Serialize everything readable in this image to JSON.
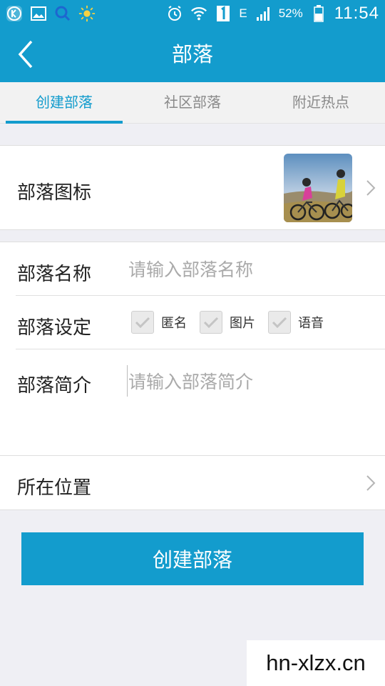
{
  "status_bar": {
    "icons": [
      "k-app-icon",
      "gallery-icon",
      "search-icon",
      "weather-sun-icon",
      "alarm-icon",
      "wifi-icon",
      "sim-1-icon",
      "signal-icon",
      "battery-icon"
    ],
    "network_type": "E",
    "battery": "52%",
    "time": "11:54"
  },
  "header": {
    "title": "部落"
  },
  "tabs": [
    {
      "label": "创建部落",
      "active": true
    },
    {
      "label": "社区部落",
      "active": false
    },
    {
      "label": "附近热点",
      "active": false
    }
  ],
  "form": {
    "icon_label": "部落图标",
    "name_label": "部落名称",
    "name_placeholder": "请输入部落名称",
    "name_value": "",
    "setting_label": "部落设定",
    "settings": [
      {
        "label": "匿名",
        "checked": false
      },
      {
        "label": "图片",
        "checked": false
      },
      {
        "label": "语音",
        "checked": false
      }
    ],
    "intro_label": "部落简介",
    "intro_placeholder": "请输入部落简介",
    "intro_value": "",
    "location_label": "所在位置"
  },
  "submit_label": "创建部落",
  "watermark": "hn-xlzx.cn",
  "colors": {
    "accent": "#139ccd",
    "background": "#efeff4"
  }
}
